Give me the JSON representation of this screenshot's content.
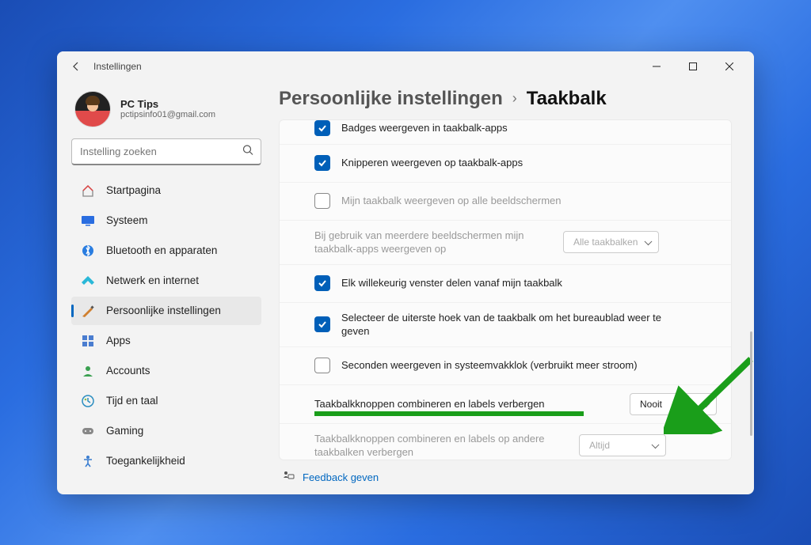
{
  "titlebar": {
    "title": "Instellingen"
  },
  "profile": {
    "name": "PC Tips",
    "email": "pctipsinfo01@gmail.com"
  },
  "search": {
    "placeholder": "Instelling zoeken"
  },
  "nav": [
    {
      "label": "Startpagina",
      "icon": "home"
    },
    {
      "label": "Systeem",
      "icon": "system"
    },
    {
      "label": "Bluetooth en apparaten",
      "icon": "bluetooth"
    },
    {
      "label": "Netwerk en internet",
      "icon": "wifi"
    },
    {
      "label": "Persoonlijke instellingen",
      "icon": "personalize",
      "active": true
    },
    {
      "label": "Apps",
      "icon": "apps"
    },
    {
      "label": "Accounts",
      "icon": "accounts"
    },
    {
      "label": "Tijd en taal",
      "icon": "time"
    },
    {
      "label": "Gaming",
      "icon": "gaming"
    },
    {
      "label": "Toegankelijkheid",
      "icon": "accessibility"
    }
  ],
  "breadcrumb": {
    "parent": "Persoonlijke instellingen",
    "sep": "›",
    "current": "Taakbalk"
  },
  "rows": {
    "r0": {
      "label": "Badges weergeven in taakbalk-apps",
      "checked": true
    },
    "r1": {
      "label": "Knipperen weergeven op taakbalk-apps",
      "checked": true
    },
    "r2": {
      "label": "Mijn taakbalk weergeven op alle beeldschermen",
      "checked": false,
      "disabled": true
    },
    "r3": {
      "label": "Bij gebruik van meerdere beeldschermen mijn taakbalk-apps weergeven op",
      "dropdown": "Alle taakbalken",
      "disabled": true
    },
    "r4": {
      "label": "Elk willekeurig venster delen vanaf mijn taakbalk",
      "checked": true
    },
    "r5": {
      "label": "Selecteer de uiterste hoek van de taakbalk om het bureaublad weer te geven",
      "checked": true
    },
    "r6": {
      "label": "Seconden weergeven in systeemvakklok (verbruikt meer stroom)",
      "checked": false
    },
    "r7": {
      "label": "Taakbalkknoppen combineren en labels verbergen",
      "dropdown": "Nooit",
      "highlight": true
    },
    "r8": {
      "label": "Taakbalkknoppen combineren en labels op andere taakbalken verbergen",
      "dropdown": "Altijd",
      "disabled": true
    }
  },
  "feedback": {
    "label": "Feedback geven"
  }
}
